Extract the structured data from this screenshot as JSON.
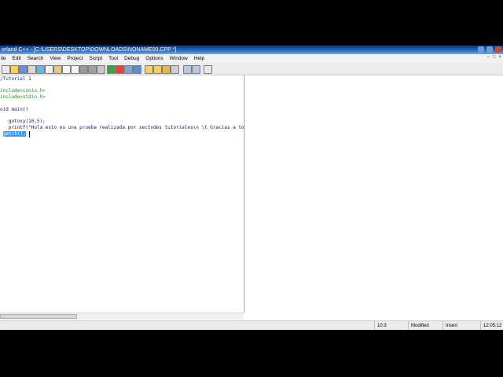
{
  "window": {
    "title": "orland C++ - [C:\\USERS\\DESKTOP\\DOWNLOADS\\NONAME00.CPP *]"
  },
  "menu": [
    "ile",
    "Edit",
    "Search",
    "View",
    "Project",
    "Script",
    "Tool",
    "Debug",
    "Options",
    "Window",
    "Help"
  ],
  "code": {
    "comment": "/Tutorial 1",
    "include1": "include<conio.h>",
    "include2": "include<stdio.h>",
    "main_decl": "oid main()",
    "line_gotoxy": "   gotoxy(10,5);",
    "line_printf": "   printf(\"Hola esto es una prueba realizada por sectodes tutoriales\\n \\t Gracias a todos por ver este tutorial y denle a like\");",
    "line_getch": "getch();"
  },
  "status": {
    "position": "10:3",
    "modified": "Modified",
    "mode": "Insert",
    "time": "12:05:12"
  },
  "colors": {
    "title_bar": "#2b6cc4",
    "selection": "#3399ff",
    "include": "#2e8b2e",
    "comment": "#1a3aa8"
  }
}
